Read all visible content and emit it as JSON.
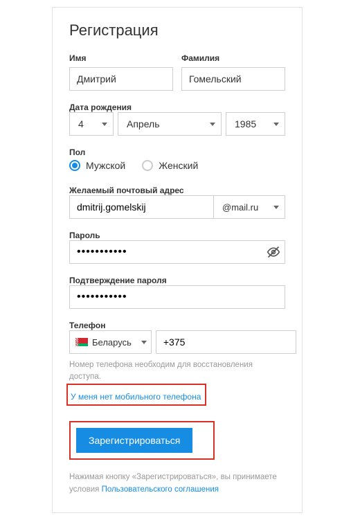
{
  "title": "Регистрация",
  "name": {
    "first_label": "Имя",
    "first_value": "Дмитрий",
    "last_label": "Фамилия",
    "last_value": "Гомельский"
  },
  "dob": {
    "label": "Дата рождения",
    "day": "4",
    "month": "Апрель",
    "year": "1985"
  },
  "gender": {
    "label": "Пол",
    "male": "Мужской",
    "female": "Женский"
  },
  "email": {
    "label": "Желаемый почтовый адрес",
    "local": "dmitrij.gomelskij",
    "domain": "@mail.ru"
  },
  "password": {
    "label": "Пароль",
    "value": "•••••••••••",
    "confirm_label": "Подтверждение пароля",
    "confirm_value": "•••••••••••"
  },
  "phone": {
    "label": "Телефон",
    "country": "Беларусь",
    "prefix": "+375",
    "hint": "Номер телефона необходим для восстановления доступа.",
    "no_phone_link": "У меня нет мобильного телефона"
  },
  "submit": {
    "label": "Зарегистрироваться"
  },
  "footer": {
    "text_before": "Нажимая кнопку «Зарегистрироваться», вы принимаете условия ",
    "agreement_link": "Пользовательского соглашения"
  }
}
